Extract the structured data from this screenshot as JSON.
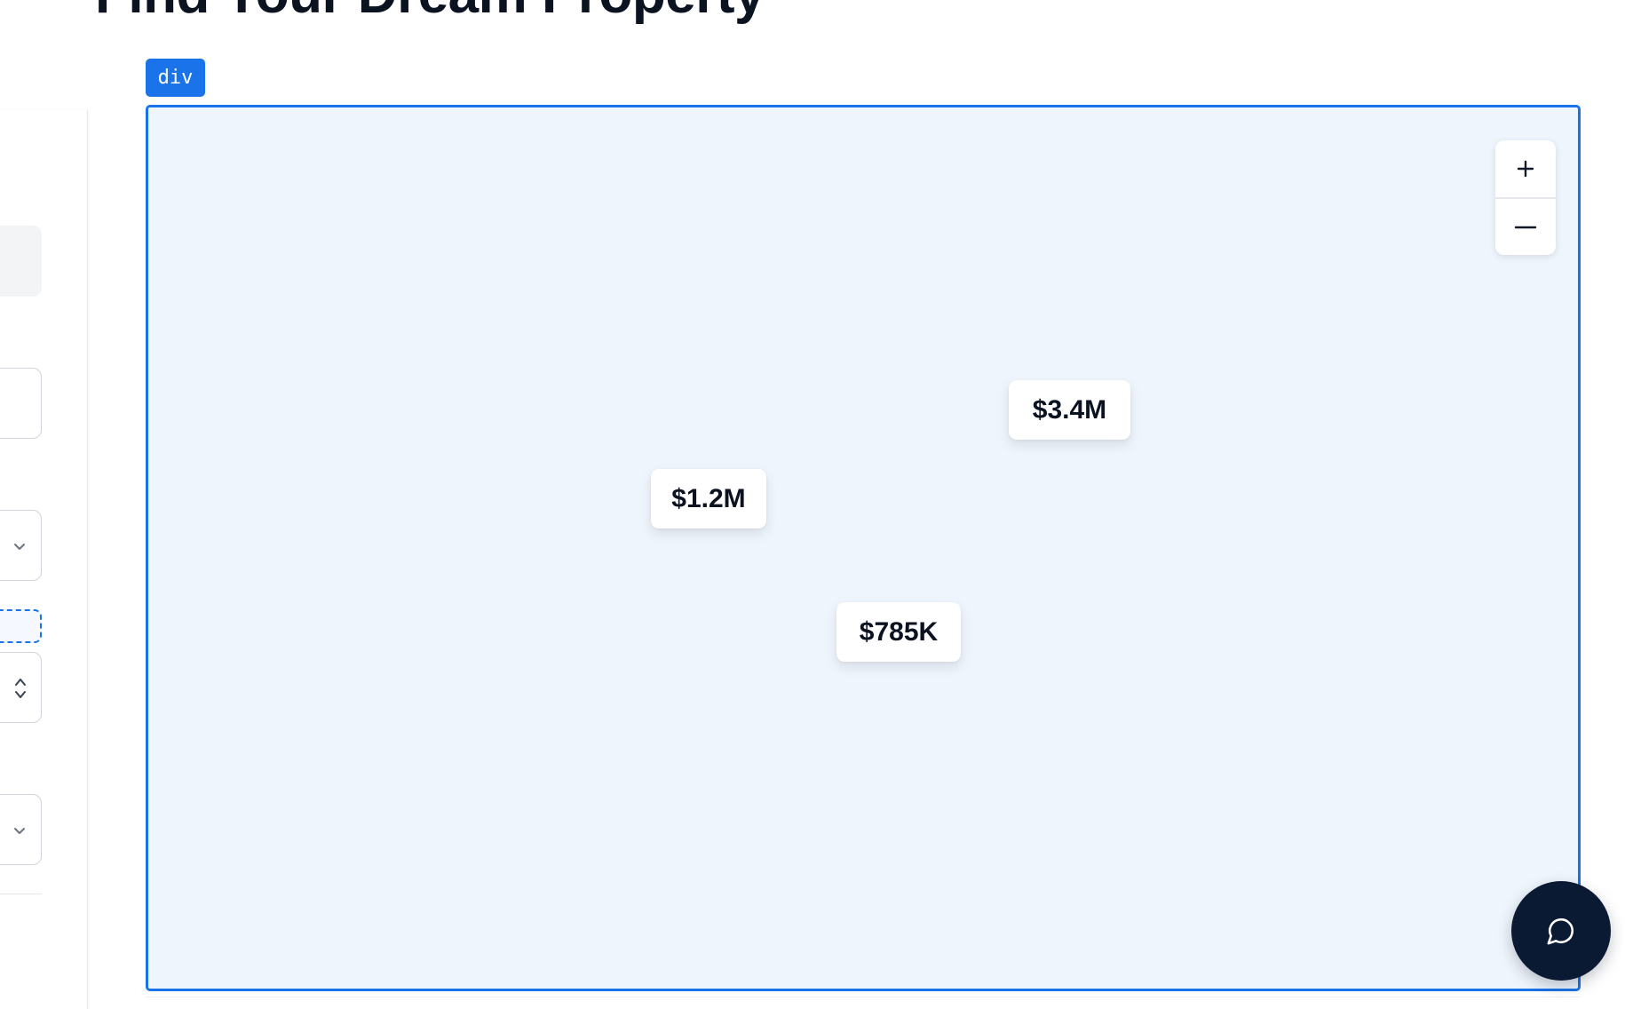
{
  "page": {
    "title": "Find Your Dream Property"
  },
  "inspector": {
    "element_tag": "div"
  },
  "map": {
    "zoom_in_icon": "plus-icon",
    "zoom_out_icon": "minus-icon",
    "price_markers": [
      {
        "label": "$1.2M"
      },
      {
        "label": "$3.4M"
      },
      {
        "label": "$785K"
      }
    ]
  },
  "chat": {
    "icon": "chat-bubble-icon"
  },
  "colors": {
    "accent": "#1a73e8",
    "map_background": "#eff5fc",
    "chat_button": "#0b1a33",
    "text": "#0b1220"
  }
}
